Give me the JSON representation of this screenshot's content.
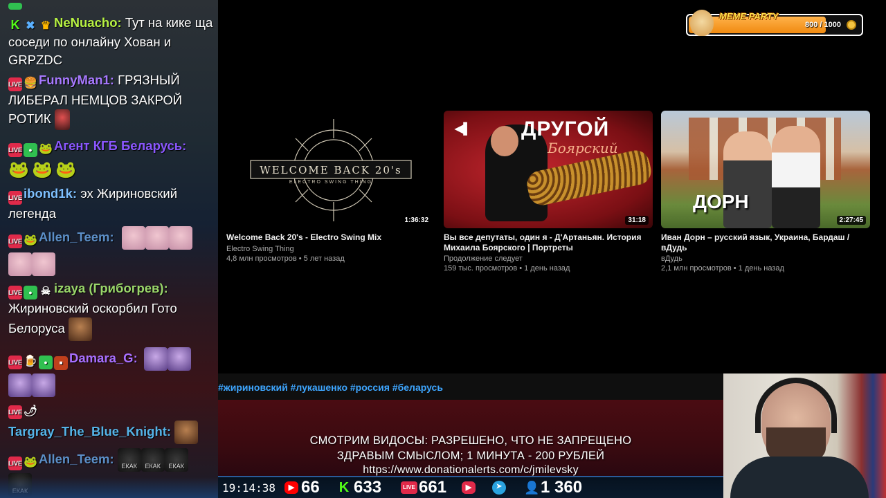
{
  "chat": {
    "messages": [
      {
        "nick": "NeNuacho",
        "nick_color": "#b7f243",
        "separator": ":",
        "text": "Тут на кике ща соседи по онлайну Хован и GRPZDC"
      },
      {
        "nick": "FunnyMan1",
        "nick_color": "#a779ff",
        "separator": ":",
        "text": "ГРЯЗНЫЙ ЛИБЕРАЛ НЕМЦОВ ЗАКРОЙ РОТИК"
      },
      {
        "nick": "Агент КГБ Беларусь",
        "nick_color": "#8b57ff",
        "separator": ":",
        "text": ""
      },
      {
        "nick": "ibond1k",
        "nick_color": "#7ec0ff",
        "separator": ":",
        "text": "эх Жириновский легенда"
      },
      {
        "nick": "Allen_Teem",
        "nick_color": "#5c8fc8",
        "separator": ":",
        "text": ""
      },
      {
        "nick": "izaya (Грибогрев)",
        "nick_color": "#9ad66a",
        "separator": ":",
        "text": "Жириновский оскорбил Гото Белоруса"
      },
      {
        "nick": "Damara_G",
        "nick_color": "#a96fff",
        "separator": ":",
        "text": ""
      },
      {
        "nick": "Targray_The_Blue_Knight",
        "nick_color": "#55b4e8",
        "separator": ":",
        "text": ""
      },
      {
        "nick": "Allen_Teem",
        "nick_color": "#5c8fc8",
        "separator": ":",
        "text": ""
      }
    ],
    "emote_text": "ЕКАК"
  },
  "meme_party": {
    "label": "MEME PARTY",
    "progress_text": "800 / 1000",
    "progress_fraction": 0.8
  },
  "videos": [
    {
      "thumb_title": "WELCOME BACK 20's",
      "thumb_sub": "ELECTRO SWING THING",
      "duration": "1:36:32",
      "title": "Welcome Back 20's - Electro Swing Mix",
      "channel": "Electro Swing Thing",
      "meta": "4,8 млн просмотров • 5 лет назад"
    },
    {
      "thumb_title": "ДРУГОЙ",
      "thumb_sub": "Боярский",
      "duration": "31:18",
      "title": "Вы все депутаты, один я - Д'Артаньян. История Михаила Боярского | Портреты",
      "channel": "Продолжение следует",
      "meta": "159 тыс. просмотров • 1 день назад"
    },
    {
      "thumb_title": "ДОРН",
      "duration": "2:27:45",
      "title": "Иван Дорн – русский язык, Украина, Бардаш / вДудь",
      "channel": "вДудь",
      "meta": "2,1 млн просмотров • 1 день назад"
    }
  ],
  "hashtags": "#жириновский #лукашенко #россия #беларусь",
  "banner": {
    "line1": "СМОТРИМ ВИДОСЫ: РАЗРЕШЕНО, ЧТО НЕ ЗАПРЕЩЕНО",
    "line2": "ЗДРАВЫМ СМЫСЛОМ; 1 МИНУТА - 200 РУБЛЕЙ",
    "line3": "https://www.donationalerts.com/c/jmilevsky"
  },
  "status": {
    "clock": "19:14:38",
    "youtube_count": "66",
    "kick_count": "633",
    "vk_live_count": "661",
    "total_count": "1 360"
  },
  "colors": {
    "live_badge": "#e02a4a",
    "kick_green": "#53fc18",
    "link_blue": "#3ea6ff"
  }
}
